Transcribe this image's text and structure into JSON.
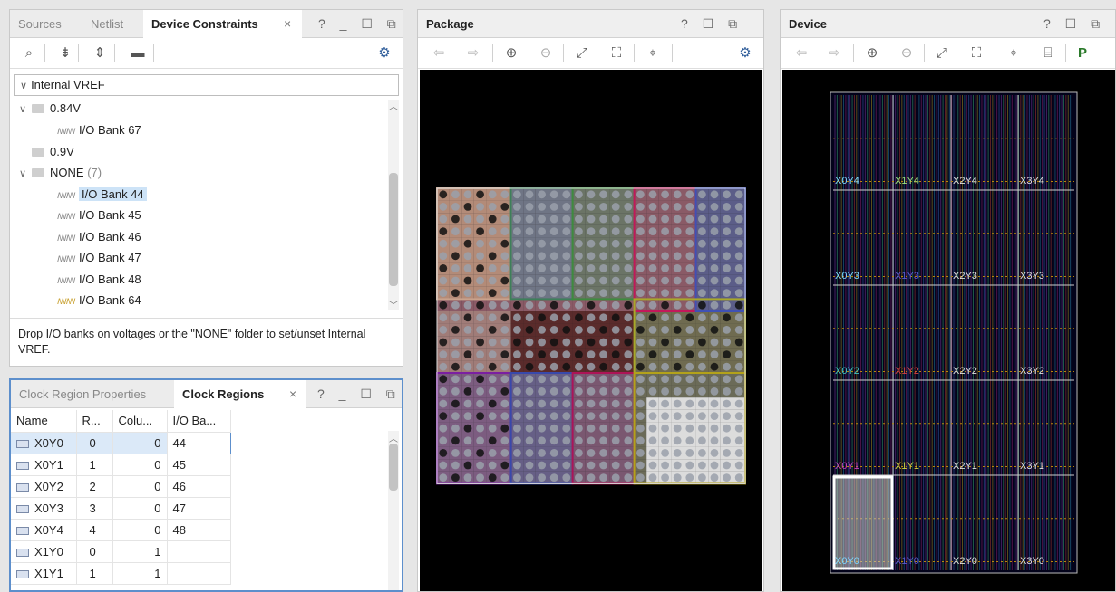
{
  "left_top": {
    "tabs": [
      "Sources",
      "Netlist",
      "Device Constraints"
    ],
    "close": "×",
    "window_buttons": "? _ ☐ ⧉",
    "filter_label": "Internal VREF",
    "tree": [
      {
        "label": "0.84V",
        "type": "folder",
        "expanded": true
      },
      {
        "label": "I/O Bank 67",
        "type": "bank"
      },
      {
        "label": "0.9V",
        "type": "folder",
        "expanded": false
      },
      {
        "label": "NONE",
        "count": "(7)",
        "type": "folder",
        "expanded": true
      },
      {
        "label": "I/O Bank 44",
        "type": "bank",
        "selected": true
      },
      {
        "label": "I/O Bank 45",
        "type": "bank"
      },
      {
        "label": "I/O Bank 46",
        "type": "bank"
      },
      {
        "label": "I/O Bank 47",
        "type": "bank"
      },
      {
        "label": "I/O Bank 48",
        "type": "bank"
      },
      {
        "label": "I/O Bank 64",
        "type": "bank"
      }
    ],
    "hint": "Drop I/O banks on voltages or the \"NONE\" folder to set/unset Internal VREF."
  },
  "left_bottom": {
    "tabs": [
      "Clock Region Properties",
      "Clock Regions"
    ],
    "close": "×",
    "window_buttons": "? _ ☐ ⧉",
    "columns": [
      "Name",
      "R...",
      "Colu...",
      "I/O Ba..."
    ],
    "rows": [
      {
        "name": "X0Y0",
        "row": "0",
        "col": "0",
        "bank": "44"
      },
      {
        "name": "X0Y1",
        "row": "1",
        "col": "0",
        "bank": "45"
      },
      {
        "name": "X0Y2",
        "row": "2",
        "col": "0",
        "bank": "46"
      },
      {
        "name": "X0Y3",
        "row": "3",
        "col": "0",
        "bank": "47"
      },
      {
        "name": "X0Y4",
        "row": "4",
        "col": "0",
        "bank": "48"
      },
      {
        "name": "X1Y0",
        "row": "0",
        "col": "1",
        "bank": ""
      },
      {
        "name": "X1Y1",
        "row": "1",
        "col": "1",
        "bank": ""
      }
    ]
  },
  "package": {
    "title": "Package",
    "window_buttons": "? ☐ ⧉ ×"
  },
  "device": {
    "title": "Device",
    "window_buttons": "? ☐ ⧉ ×",
    "regions": [
      [
        "X0Y4",
        "X1Y4",
        "X2Y4",
        "X3Y4"
      ],
      [
        "X0Y3",
        "X1Y3",
        "X2Y3",
        "X3Y3"
      ],
      [
        "X0Y2",
        "X1Y2",
        "X2Y2",
        "X3Y2"
      ],
      [
        "X0Y1",
        "X1Y1",
        "X2Y1",
        "X3Y1"
      ],
      [
        "X0Y0",
        "X1Y0",
        "X2Y0",
        "X3Y0"
      ]
    ]
  },
  "colors": {
    "accent_blue": "#4a7fc1",
    "selection": "#cde3f7"
  }
}
